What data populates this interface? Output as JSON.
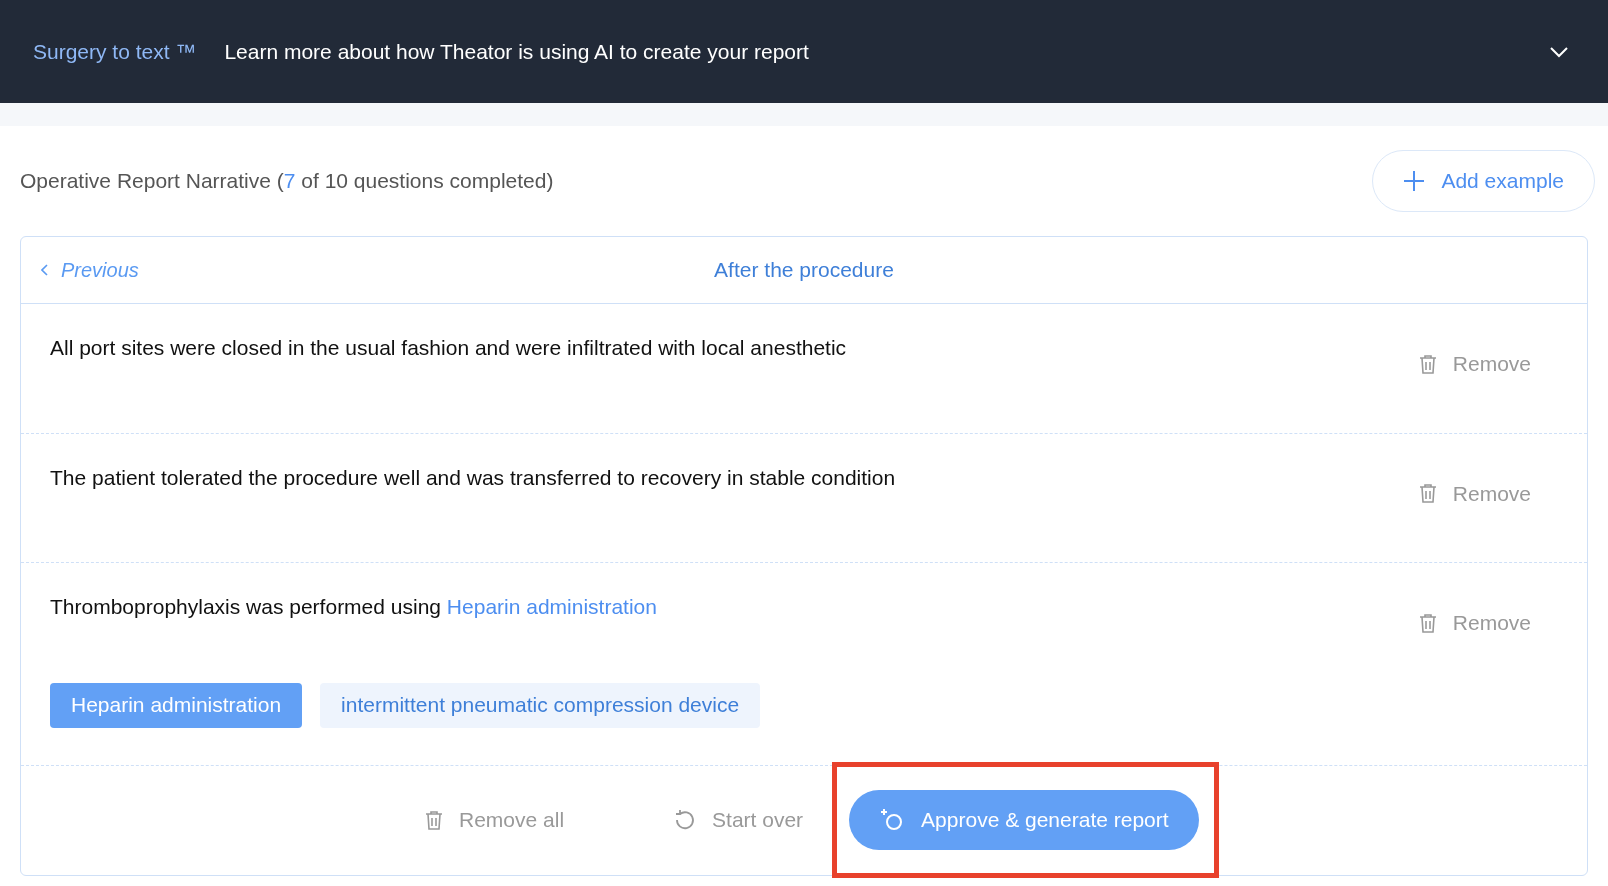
{
  "banner": {
    "brand": "Surgery to text ™",
    "message": "Learn more about how Theator is using AI to create your report",
    "expanded": false
  },
  "header": {
    "title": "Operative Report Narrative (",
    "done": "7",
    "rest": " of 10 questions completed)",
    "add_button": "Add example"
  },
  "card": {
    "previous": "Previous",
    "section": "After the procedure",
    "rows": [
      {
        "text": "All port sites were closed in the usual fashion and were infiltrated with local anesthetic",
        "remove": "Remove"
      },
      {
        "text": "The patient tolerated the procedure well and was transferred to recovery in stable condition",
        "remove": "Remove"
      },
      {
        "text": "Thromboprophylaxis was performed using ",
        "link": "Heparin administration",
        "remove": "Remove",
        "chips": [
          {
            "label": "Heparin administration",
            "selected": true
          },
          {
            "label": "intermittent pneumatic compression device",
            "selected": false
          }
        ]
      }
    ],
    "footer": {
      "remove_all": "Remove all",
      "start_over": "Start over",
      "approve": "Approve & generate report",
      "highlighted": true
    }
  }
}
